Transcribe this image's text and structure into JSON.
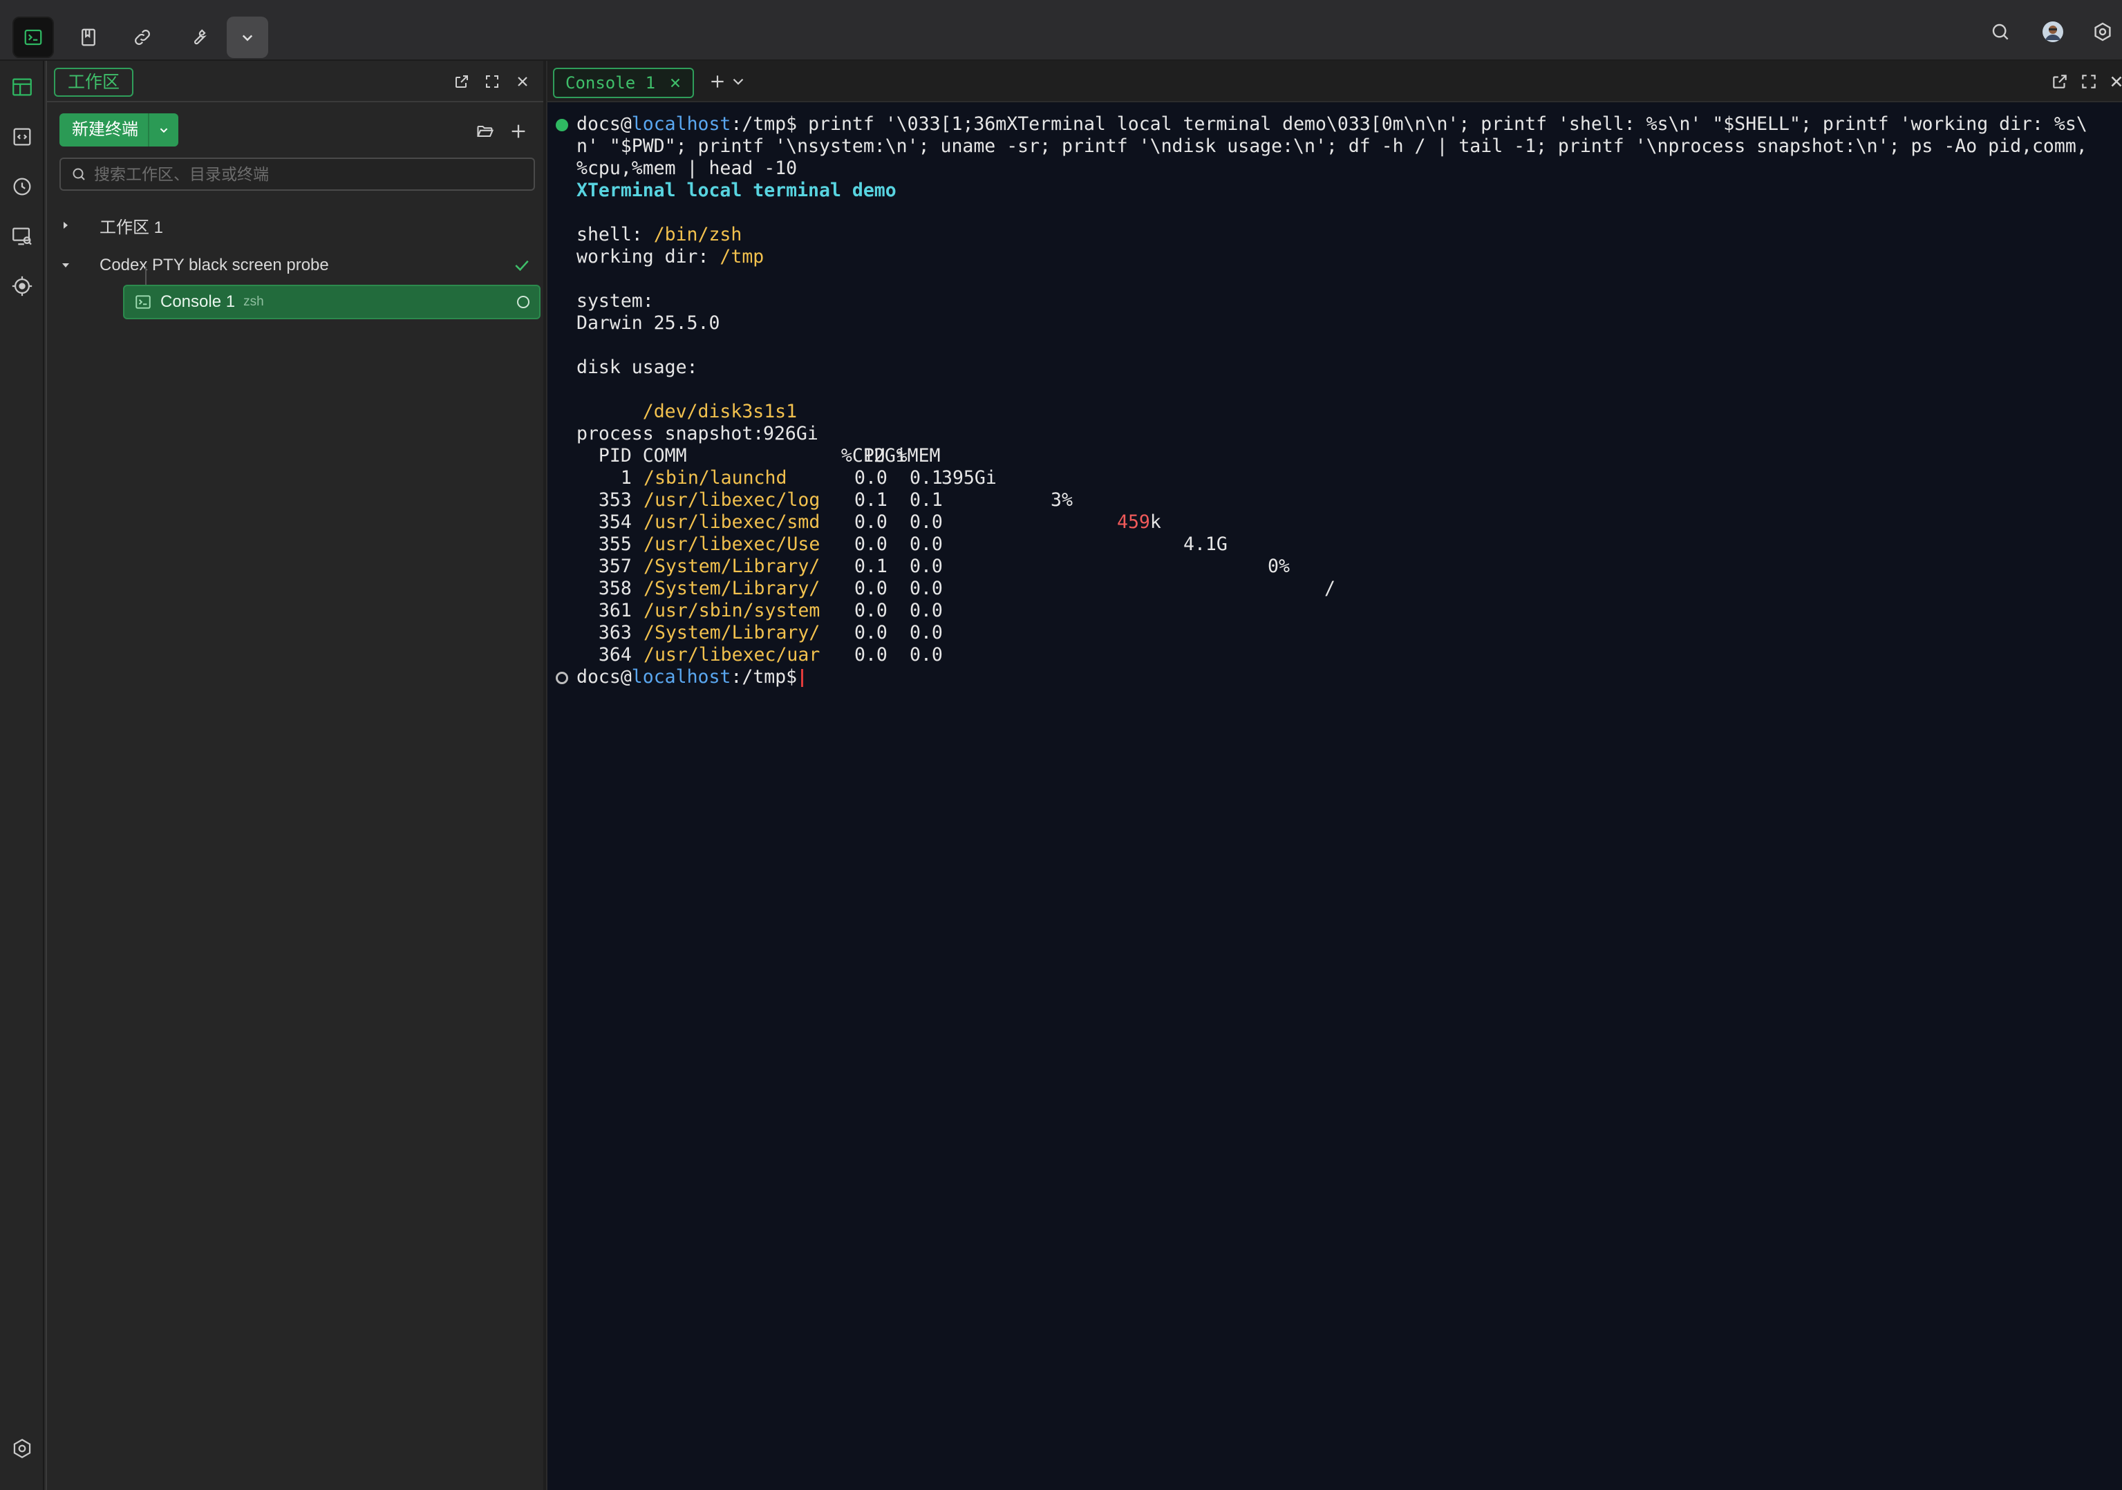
{
  "sidebar": {
    "tab_label": "工作区",
    "new_terminal_label": "新建终端",
    "search_placeholder": "搜索工作区、目录或终端",
    "tree": {
      "workspace1": "工作区 1",
      "probe": "Codex PTY black screen probe",
      "console_name": "Console 1",
      "console_shell": "zsh"
    }
  },
  "terminal": {
    "tab_label": "Console 1",
    "user": "docs",
    "at": "@",
    "host": "localhost",
    "cwd": ":/tmp$",
    "cmd_line1": " printf '\\033[1;36mXTerminal local terminal demo\\033[0m\\n\\n'; printf 'shell: %s\\n' \"$SHELL\"; printf 'working dir: %s\\",
    "cmd_line2": "n' \"$PWD\"; printf '\\nsystem:\\n'; uname -sr; printf '\\ndisk usage:\\n'; df -h / | tail -1; printf '\\nprocess snapshot:\\n'; ps -Ao pid,comm,",
    "cmd_line3": "%cpu,%mem | head -10",
    "banner": "XTerminal local terminal demo",
    "shell_label": "shell: ",
    "shell_value": "/bin/zsh",
    "wd_label": "working dir: ",
    "wd_value": "/tmp",
    "system_label": "system:",
    "system_value": "Darwin 25.5.0",
    "disk_label": "disk usage:",
    "disk": {
      "device": "/dev/disk3s1s1",
      "size": "926Gi",
      "used": "12Gi",
      "avail": "395Gi",
      "capacity": "3%",
      "iused_red": "459",
      "iused_suffix": "k",
      "ifree": "4.1G",
      "ipct": "0%",
      "mount": "/"
    },
    "proc_label": "process snapshot:",
    "proc_header": "  PID COMM              %CPU %MEM",
    "processes": [
      {
        "pid": "    1",
        "comm": "/sbin/launchd",
        "cpu": "0.0",
        "mem": "0.1"
      },
      {
        "pid": "  353",
        "comm": "/usr/libexec/log",
        "cpu": "0.1",
        "mem": "0.1"
      },
      {
        "pid": "  354",
        "comm": "/usr/libexec/smd",
        "cpu": "0.0",
        "mem": "0.0"
      },
      {
        "pid": "  355",
        "comm": "/usr/libexec/Use",
        "cpu": "0.0",
        "mem": "0.0"
      },
      {
        "pid": "  357",
        "comm": "/System/Library/",
        "cpu": "0.1",
        "mem": "0.0"
      },
      {
        "pid": "  358",
        "comm": "/System/Library/",
        "cpu": "0.0",
        "mem": "0.0"
      },
      {
        "pid": "  361",
        "comm": "/usr/sbin/system",
        "cpu": "0.0",
        "mem": "0.0"
      },
      {
        "pid": "  363",
        "comm": "/System/Library/",
        "cpu": "0.0",
        "mem": "0.0"
      },
      {
        "pid": "  364",
        "comm": "/usr/libexec/uar",
        "cpu": "0.0",
        "mem": "0.0"
      }
    ]
  },
  "colors": {
    "accent_green": "#2b9a55",
    "terminal_bg": "#0d111c",
    "path_yellow": "#f2c14e",
    "host_blue": "#5aa7f0",
    "banner_cyan": "#58d4e0",
    "alert_red": "#f05a5a"
  },
  "icons": {
    "topbar": [
      "terminal-icon",
      "bookmark-icon",
      "link-icon",
      "wrench-icon",
      "chevron-down-icon"
    ],
    "topbar_right": [
      "search-icon",
      "avatar",
      "settings-icon"
    ],
    "activity": [
      "layout-icon",
      "code-icon",
      "history-icon",
      "screen-search-icon",
      "target-icon",
      "settings-icon"
    ]
  }
}
